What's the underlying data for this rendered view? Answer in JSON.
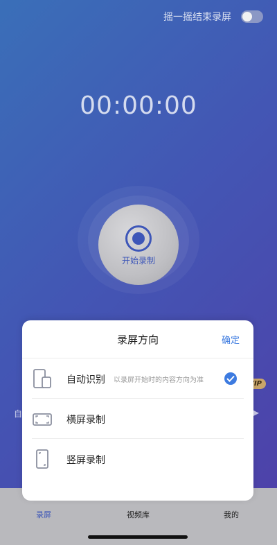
{
  "top": {
    "shake_label": "摇一摇结束录屏",
    "toggle_on": false
  },
  "timer": "00:00:00",
  "record": {
    "label": "开始录制"
  },
  "background": {
    "left_partial": "自",
    "vip_badge": "VIP",
    "right_arrow": "▶"
  },
  "sheet": {
    "title": "录屏方向",
    "confirm_label": "确定",
    "options": [
      {
        "label": "自动识别",
        "desc": "以录屏开始时的内容方向为准",
        "selected": true,
        "icon": "auto-rotate-icon"
      },
      {
        "label": "横屏录制",
        "desc": "",
        "selected": false,
        "icon": "landscape-icon"
      },
      {
        "label": "竖屏录制",
        "desc": "",
        "selected": false,
        "icon": "portrait-icon"
      }
    ]
  },
  "tabs": [
    {
      "label": "录屏",
      "active": true,
      "icon": "record-tab-icon"
    },
    {
      "label": "视频库",
      "active": false,
      "icon": "library-tab-icon"
    },
    {
      "label": "我的",
      "active": false,
      "icon": "profile-tab-icon"
    }
  ],
  "colors": {
    "accent": "#3d56b8",
    "confirm_blue": "#3d7be0"
  }
}
